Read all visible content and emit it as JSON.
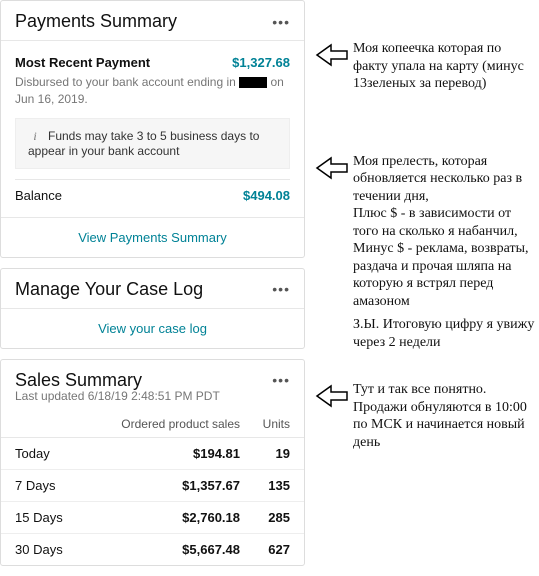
{
  "payments": {
    "title": "Payments Summary",
    "recent_label": "Most Recent Payment",
    "recent_value": "$1,327.68",
    "disbursed_prefix": "Disbursed to your bank account ending in",
    "disbursed_suffix": "on Jun 16, 2019.",
    "info_text": "Funds may take 3 to 5 business days to appear in your bank account",
    "balance_label": "Balance",
    "balance_value": "$494.08",
    "footer_link": "View Payments Summary"
  },
  "caselog": {
    "title": "Manage Your Case Log",
    "footer_link": "View your case log"
  },
  "sales": {
    "title": "Sales Summary",
    "updated": "Last updated 6/18/19 2:48:51 PM PDT",
    "col_sales": "Ordered product sales",
    "col_units": "Units",
    "rows": [
      {
        "period": "Today",
        "sales": "$194.81",
        "units": "19"
      },
      {
        "period": "7 Days",
        "sales": "$1,357.67",
        "units": "135"
      },
      {
        "period": "15 Days",
        "sales": "$2,760.18",
        "units": "285"
      },
      {
        "period": "30 Days",
        "sales": "$5,667.48",
        "units": "627"
      }
    ]
  },
  "annotations": {
    "a1": "Моя копеечка которая по факту упала на карту (минус 13зеленых за перевод)",
    "a2": "Моя прелесть, которая обновляется несколько раз в течении дня,\nПлюс $ - в зависимости от того на сколько я набанчил,\nМинус $ - реклама, возвраты, раздача и прочая шляпа на которую я встрял перед амазоном",
    "a2b": "З.Ы. Итоговую цифру я увижу через 2 недели",
    "a3": "Тут и так все понятно. Продажи обнуляются в 10:00 по МСК и начинается новый день"
  }
}
